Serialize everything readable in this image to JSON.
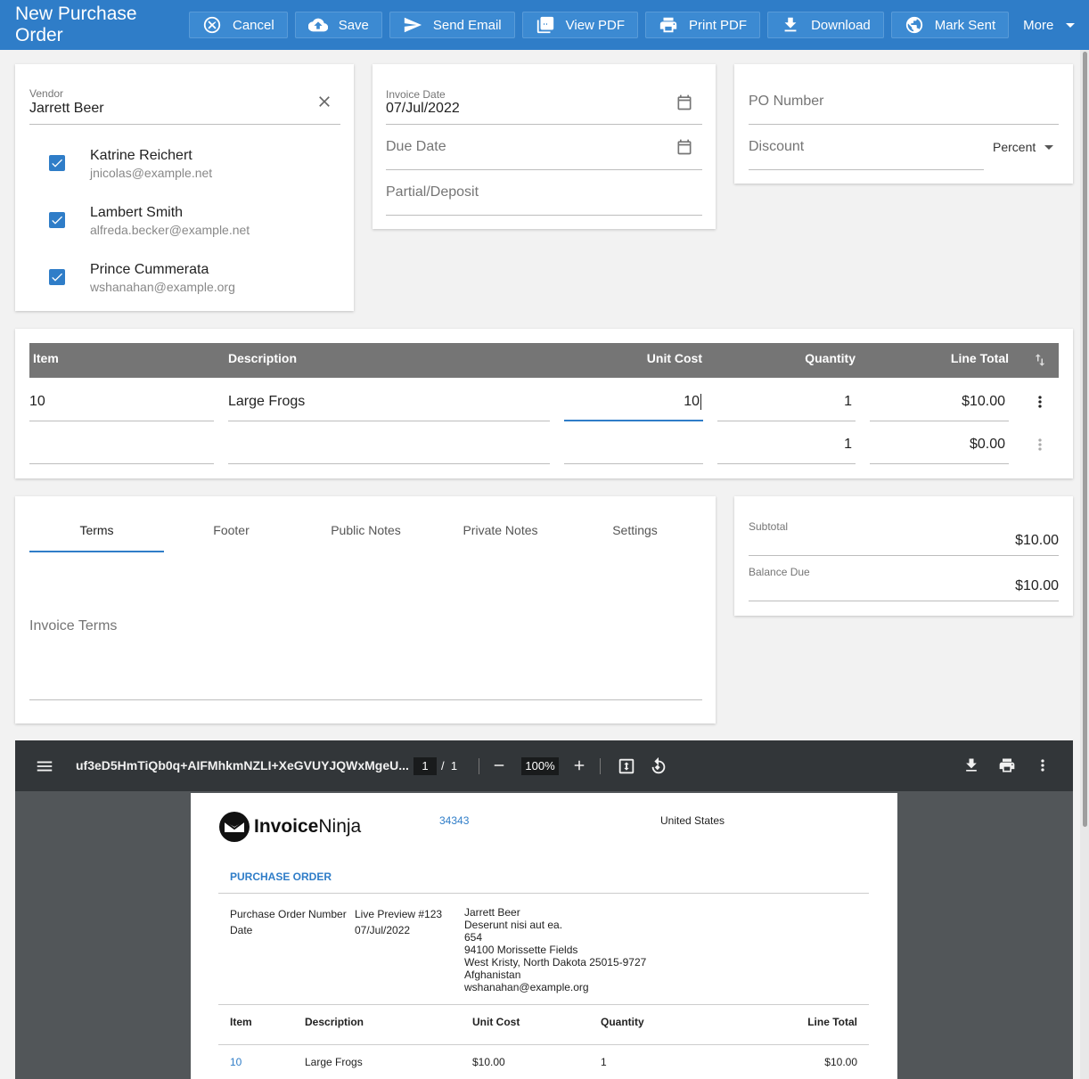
{
  "header": {
    "title": "New Purchase Order",
    "buttons": {
      "cancel": "Cancel",
      "save": "Save",
      "send_email": "Send Email",
      "view_pdf": "View PDF",
      "print_pdf": "Print PDF",
      "download": "Download",
      "mark_sent": "Mark Sent",
      "more": "More"
    }
  },
  "vendor": {
    "label": "Vendor",
    "value": "Jarrett Beer",
    "contacts": [
      {
        "name": "Katrine Reichert",
        "email": "jnicolas@example.net",
        "checked": true
      },
      {
        "name": "Lambert Smith",
        "email": "alfreda.becker@example.net",
        "checked": true
      },
      {
        "name": "Prince Cummerata",
        "email": "wshanahan@example.org",
        "checked": true
      }
    ]
  },
  "dates": {
    "invoice_date_label": "Invoice Date",
    "invoice_date": "07/Jul/2022",
    "due_date_placeholder": "Due Date",
    "partial_placeholder": "Partial/Deposit"
  },
  "po": {
    "po_number_placeholder": "PO Number",
    "discount_placeholder": "Discount",
    "discount_type": "Percent"
  },
  "items": {
    "headers": {
      "item": "Item",
      "description": "Description",
      "unit_cost": "Unit Cost",
      "quantity": "Quantity",
      "line_total": "Line Total"
    },
    "rows": [
      {
        "item": "10",
        "description": "Large Frogs",
        "unit_cost": "10",
        "quantity": "1",
        "line_total": "$10.00"
      },
      {
        "item": "",
        "description": "",
        "unit_cost": "",
        "quantity": "1",
        "line_total": "$0.00"
      }
    ]
  },
  "notes": {
    "tabs": [
      "Terms",
      "Footer",
      "Public Notes",
      "Private Notes",
      "Settings"
    ],
    "active_tab": "Terms",
    "terms_placeholder": "Invoice Terms"
  },
  "totals": {
    "subtotal_label": "Subtotal",
    "subtotal": "$10.00",
    "balance_label": "Balance Due",
    "balance": "$10.00"
  },
  "pdf_viewer": {
    "filename": "uf3eD5HmTiQb0q+AIFMhkmNZLI+XeGVUYJQWxMgeU...",
    "page": "1",
    "page_sep": "/",
    "page_total": "1",
    "zoom": "100%"
  },
  "pdf_page": {
    "logo_bold": "Invoice",
    "logo_light": "Ninja",
    "company_id": "34343",
    "country": "United States",
    "doc_title": "PURCHASE ORDER",
    "po_number_label": "Purchase Order Number",
    "po_number": "Live Preview #123",
    "date_label": "Date",
    "date": "07/Jul/2022",
    "vendor_lines": [
      "Jarrett Beer",
      "Deserunt nisi aut ea.",
      "654",
      "94100 Morissette Fields",
      "West Kristy, North Dakota 25015-9727",
      "Afghanistan",
      "wshanahan@example.org"
    ],
    "table_headers": {
      "item": "Item",
      "description": "Description",
      "unit_cost": "Unit Cost",
      "quantity": "Quantity",
      "line_total": "Line Total"
    },
    "rows": [
      {
        "item": "10",
        "description": "Large Frogs",
        "unit_cost": "$10.00",
        "quantity": "1",
        "line_total": "$10.00"
      }
    ]
  },
  "colors": {
    "primary": "#2f7dc8",
    "toolbar": "#323639"
  }
}
